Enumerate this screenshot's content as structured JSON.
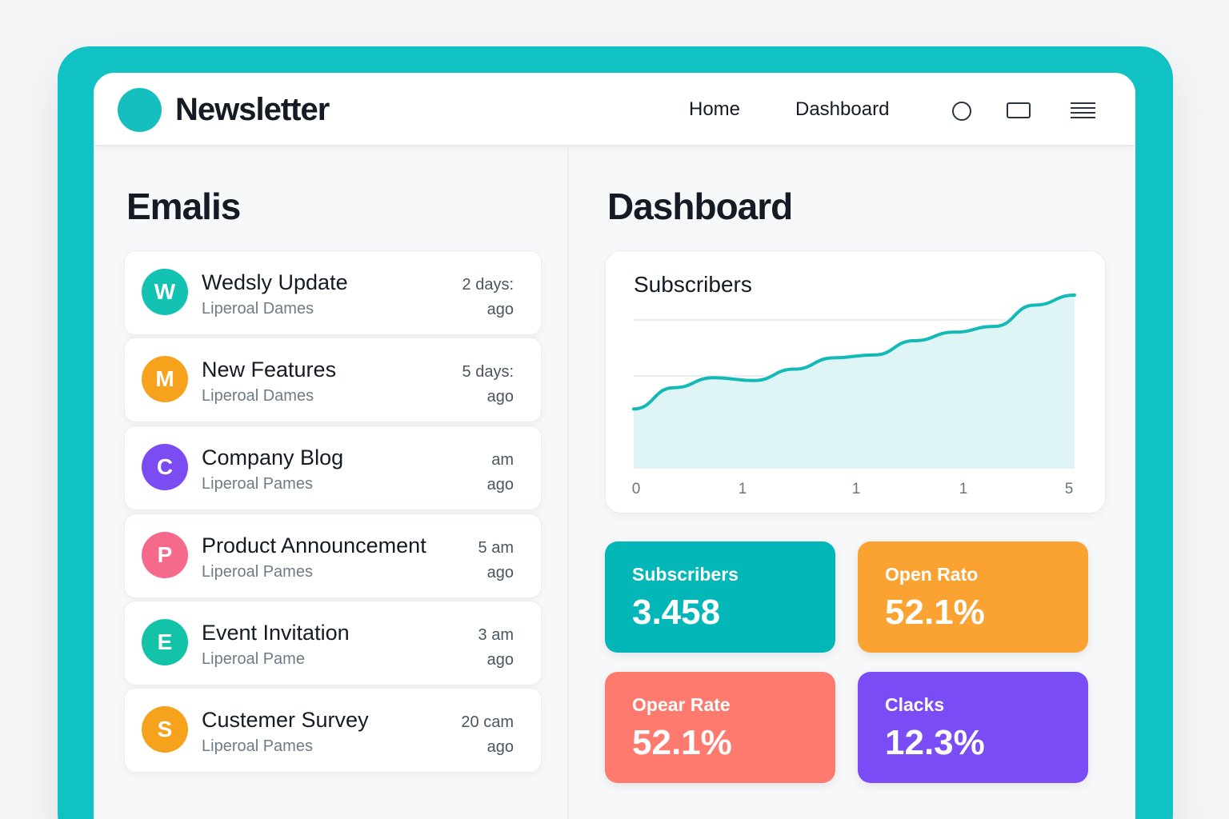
{
  "brand": {
    "name": "Newsletter",
    "logo_color": "#14bfbd"
  },
  "nav": {
    "home": "Home",
    "dashboard": "Dashboard"
  },
  "icons": [
    "search-icon",
    "window-icon",
    "menu-icon"
  ],
  "emails_section": {
    "title": "Emalis",
    "items": [
      {
        "initial": "W",
        "color": "#12c3b3",
        "subject": "Wedsly Update",
        "sender": "Liperoal Dames",
        "time_line1": "2 days:",
        "time_line2": "ago"
      },
      {
        "initial": "M",
        "color": "#f7a21d",
        "subject": "New Features",
        "sender": "Liperoal Dames",
        "time_line1": "5 days:",
        "time_line2": "ago"
      },
      {
        "initial": "C",
        "color": "#7a4cf2",
        "subject": "Company Blog",
        "sender": "Liperoal Pames",
        "time_line1": "am",
        "time_line2": "ago"
      },
      {
        "initial": "P",
        "color": "#f56a8a",
        "subject": "Product Announcement",
        "sender": "Liperoal Pames",
        "time_line1": "5 am",
        "time_line2": "ago"
      },
      {
        "initial": "E",
        "color": "#12c3a7",
        "subject": "Event Invitation",
        "sender": "Liperoal Pame",
        "time_line1": "3 am",
        "time_line2": "ago"
      },
      {
        "initial": "S",
        "color": "#f7a21d",
        "subject": "Custemer Survey",
        "sender": "Liperoal Pames",
        "time_line1": "20 cam",
        "time_line2": "ago"
      }
    ]
  },
  "dashboard_section": {
    "title": "Dashboard",
    "stats": [
      {
        "label": "Subscribers",
        "value": "3.458",
        "color": "#03b6b8"
      },
      {
        "label": "Open Rato",
        "value": "52.1%",
        "color": "#fba332"
      },
      {
        "label": "Opear Rate",
        "value": "52.1%",
        "color": "#ff7a6e"
      },
      {
        "label": "Clacks",
        "value": "12.3%",
        "color": "#7a4cf5"
      }
    ]
  },
  "chart_data": {
    "type": "area",
    "title": "Subscribers",
    "x_tick_labels": [
      "0",
      "1",
      "1",
      "1",
      "5"
    ],
    "series_trend": [
      0.2,
      0.35,
      0.42,
      0.4,
      0.48,
      0.56,
      0.58,
      0.68,
      0.74,
      0.78,
      0.93,
      1.0
    ],
    "line_color": "#12b9b6",
    "fill_color": "#dff4f5",
    "grid": true
  }
}
